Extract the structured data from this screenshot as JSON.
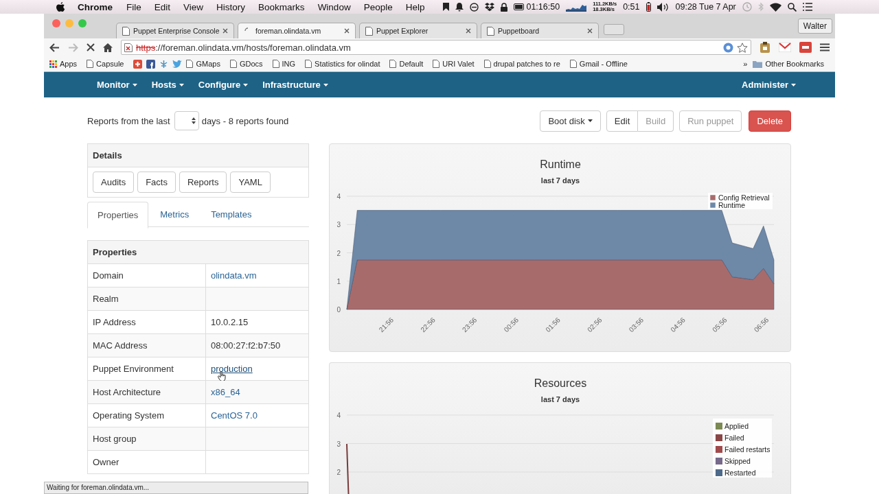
{
  "menubar": {
    "app": "Chrome",
    "menus": [
      "File",
      "Edit",
      "View",
      "History",
      "Bookmarks",
      "Window",
      "People",
      "Help"
    ],
    "timer": "01:16:50",
    "upload": "111.2KB/s",
    "download": "18.3KB/s",
    "battery": "0:51",
    "clock": "09:28 Tue 7 Apr"
  },
  "tabs": [
    {
      "title": "Puppet Enterprise Console",
      "selected": false
    },
    {
      "title": "foreman.olindata.vm",
      "selected": true
    },
    {
      "title": "Puppet Explorer",
      "selected": false
    },
    {
      "title": "Puppetboard",
      "selected": false
    }
  ],
  "profile": "Walter",
  "address": {
    "scheme": "https",
    "rest": "://foreman.olindata.vm/hosts/foreman.olindata.vm"
  },
  "bookmarks": [
    "Apps",
    "Capsule",
    "GMaps",
    "GDocs",
    "ING",
    "Statistics for olindat",
    "Default",
    "URI Valet",
    "drupal patches to re",
    "Gmail - Offline"
  ],
  "bookmarks_overflow": "»",
  "other_bookmarks": "Other Bookmarks",
  "nav": {
    "left": [
      "Monitor",
      "Hosts",
      "Configure",
      "Infrastructure"
    ],
    "right": [
      "Administer"
    ]
  },
  "reports": {
    "prefix": "Reports from the last",
    "suffix": "days - 8 reports found"
  },
  "action_groups": [
    {
      "buttons": [
        {
          "label": "Boot disk",
          "kind": "dropdown",
          "disabled": false
        }
      ]
    },
    {
      "buttons": [
        {
          "label": "Edit",
          "kind": "default",
          "disabled": false
        },
        {
          "label": "Build",
          "kind": "default",
          "disabled": true
        }
      ]
    },
    {
      "buttons": [
        {
          "label": "Run puppet",
          "kind": "default",
          "disabled": true
        }
      ]
    },
    {
      "buttons": [
        {
          "label": "Delete",
          "kind": "danger",
          "disabled": false
        }
      ]
    }
  ],
  "details": {
    "title": "Details",
    "buttons": [
      "Audits",
      "Facts",
      "Reports",
      "YAML"
    ]
  },
  "detail_tabs": [
    {
      "label": "Properties",
      "selected": true
    },
    {
      "label": "Metrics",
      "selected": false
    },
    {
      "label": "Templates",
      "selected": false
    }
  ],
  "properties": {
    "title": "Properties",
    "rows": [
      {
        "label": "Domain",
        "kind": "link",
        "value": "olindata.vm",
        "hovered": false
      },
      {
        "label": "Realm",
        "kind": "empty",
        "hovered": false
      },
      {
        "label": "IP Address",
        "kind": "text",
        "value": "10.0.2.15",
        "hovered": false
      },
      {
        "label": "MAC Address",
        "kind": "text",
        "value": "08:00:27:f2:b7:50",
        "hovered": false
      },
      {
        "label": "Puppet Environment",
        "kind": "link",
        "value": "production",
        "hovered": true
      },
      {
        "label": "Host Architecture",
        "kind": "link",
        "value": "x86_64",
        "hovered": false
      },
      {
        "label": "Operating System",
        "kind": "link",
        "value": "CentOS 7.0",
        "hovered": false
      },
      {
        "label": "Host group",
        "kind": "empty",
        "hovered": false
      },
      {
        "label": "Owner",
        "kind": "empty",
        "hovered": false
      }
    ]
  },
  "runtime": {
    "subtitle": "last 7 days",
    "chart_data": {
      "type": "area",
      "title": "Runtime",
      "stacked": true,
      "categories": [
        null,
        null,
        null,
        null,
        "21:56",
        null,
        null,
        null,
        "22:56",
        null,
        null,
        null,
        "23:56",
        null,
        null,
        null,
        "00:56",
        null,
        null,
        null,
        "01:56",
        null,
        null,
        null,
        "02:56",
        null,
        null,
        null,
        "03:56",
        null,
        null,
        null,
        "04:56",
        null,
        null,
        null,
        "05:56",
        null,
        null,
        null,
        "06:56",
        null
      ],
      "series": [
        {
          "name": "Config Retrieval",
          "color": "#a86b6b",
          "values": [
            0,
            1.75,
            1.75,
            1.75,
            1.75,
            1.75,
            1.75,
            1.75,
            1.75,
            1.75,
            1.75,
            1.75,
            1.75,
            1.75,
            1.75,
            1.75,
            1.75,
            1.75,
            1.75,
            1.75,
            1.75,
            1.75,
            1.75,
            1.75,
            1.75,
            1.75,
            1.75,
            1.75,
            1.75,
            1.75,
            1.75,
            1.75,
            1.75,
            1.75,
            1.75,
            1.75,
            1.75,
            1.15,
            1.1,
            1.05,
            1.45,
            0.9
          ]
        },
        {
          "name": "Runtime",
          "color": "#6e88a8",
          "values": [
            0,
            1.75,
            1.75,
            1.75,
            1.75,
            1.75,
            1.75,
            1.75,
            1.75,
            1.75,
            1.75,
            1.75,
            1.75,
            1.75,
            1.75,
            1.75,
            1.75,
            1.75,
            1.75,
            1.75,
            1.75,
            1.75,
            1.75,
            1.75,
            1.75,
            1.75,
            1.75,
            1.75,
            1.75,
            1.75,
            1.75,
            1.75,
            1.75,
            1.75,
            1.75,
            1.75,
            1.75,
            1.2,
            1.15,
            1.1,
            1.5,
            0.85
          ]
        }
      ],
      "ylim": [
        0,
        4
      ],
      "yticks": [
        0,
        1,
        2,
        3,
        4
      ],
      "grid": true
    }
  },
  "resources": {
    "title": "Resources",
    "subtitle": "last 7 days",
    "axis_labels": [
      "4",
      "3",
      "2"
    ],
    "legend": [
      {
        "name": "Applied",
        "color": "#7b8a52"
      },
      {
        "name": "Failed",
        "color": "#8a4646"
      },
      {
        "name": "Failed restarts",
        "color": "#a04a4c"
      },
      {
        "name": "Skipped",
        "color": "#76698a"
      },
      {
        "name": "Restarted",
        "color": "#4d6a8a"
      }
    ]
  },
  "status_text": "Waiting for foreman.olindata.vm..."
}
